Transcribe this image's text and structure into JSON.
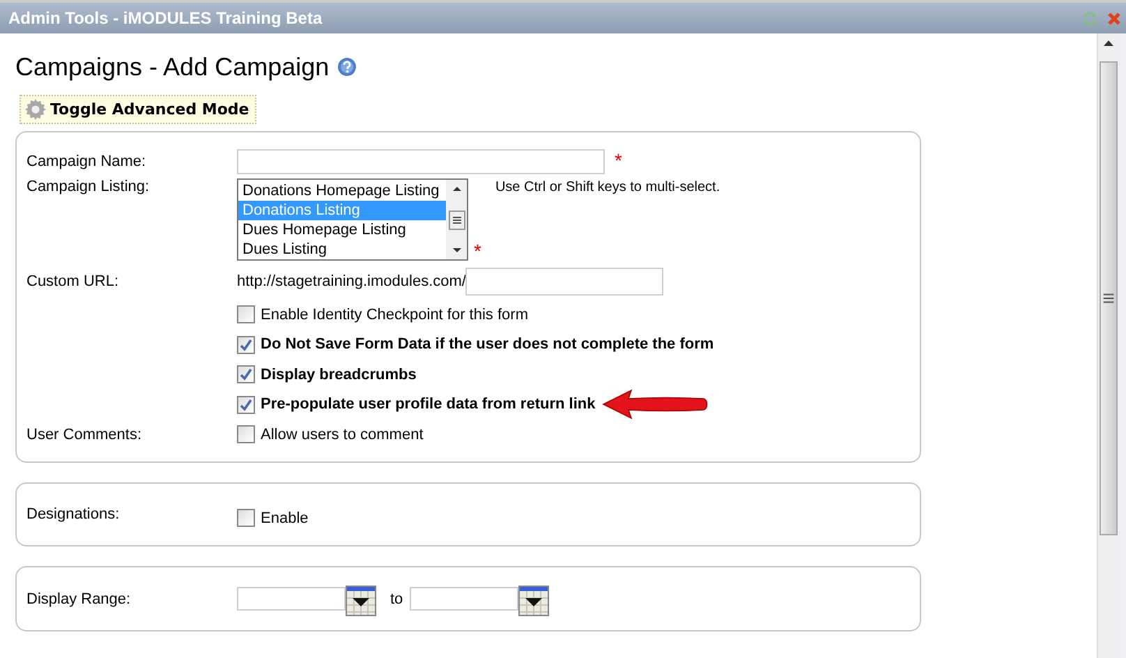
{
  "window": {
    "title": "Admin Tools - iMODULES Training Beta"
  },
  "page_title": "Campaigns - Add Campaign",
  "toggle_button": {
    "label": "Toggle Advanced Mode"
  },
  "campaign_name": {
    "label": "Campaign Name:",
    "required_mark": "*"
  },
  "campaign_listing": {
    "label": "Campaign Listing:",
    "required_mark": "*",
    "hint": "Use Ctrl or Shift keys to multi-select.",
    "options": [
      {
        "label": "Donations Homepage Listing",
        "selected": false
      },
      {
        "label": "Donations Listing",
        "selected": true
      },
      {
        "label": "Dues Homepage Listing",
        "selected": false
      },
      {
        "label": "Dues Listing",
        "selected": false
      }
    ]
  },
  "custom_url": {
    "label": "Custom URL:",
    "prefix": "http://stagetraining.imodules.com/"
  },
  "options": [
    {
      "label": "Enable Identity Checkpoint for this form",
      "checked": false
    },
    {
      "label": "Do Not Save Form Data if the user does not complete the form",
      "checked": true
    },
    {
      "label": "Display breadcrumbs",
      "checked": true
    },
    {
      "label": "Pre-populate user profile data from return link",
      "checked": true
    }
  ],
  "user_comments": {
    "label": "User Comments:",
    "option": {
      "label": "Allow users to comment",
      "checked": false
    }
  },
  "designations": {
    "label": "Designations:",
    "option": {
      "label": "Enable",
      "checked": false
    }
  },
  "display_range": {
    "label": "Display Range:",
    "separator": "to"
  }
}
